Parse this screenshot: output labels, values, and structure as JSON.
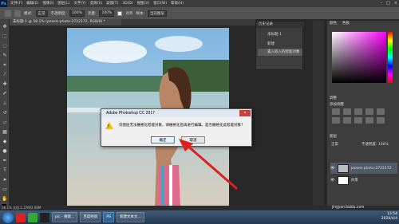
{
  "app": {
    "logo": "Ps"
  },
  "menubar": {
    "items": [
      "文件(F)",
      "编辑(E)",
      "图像(I)",
      "图层(L)",
      "文字(Y)",
      "选择(S)",
      "滤镜(T)",
      "3D(D)",
      "视图(V)",
      "窗口(W)",
      "帮助(H)"
    ],
    "controls": [
      "–",
      "□",
      "×"
    ]
  },
  "optionsbar": {
    "mode_label": "模式:",
    "mode_value": "正常",
    "opacity_label": "不透明度:",
    "opacity_value": "100%",
    "flow_label": "流量:",
    "flow_value": "100%",
    "align_label": "对齐",
    "sample_label": "样本:",
    "sample_value": "当前图层"
  },
  "document_tab": {
    "label": "未标题-1 @ 58.1% (pexels-photo-2722172, RGB/8) *"
  },
  "layer_popup": {
    "tab": "历史记录",
    "rows": [
      "未标题-1",
      "新建",
      "置入嵌入的智能对象"
    ]
  },
  "panels": {
    "color_tab": "颜色",
    "swatches_tab": "色板",
    "adjustments_tab": "调整",
    "adjustments_sub": "添加调整",
    "layers_tab": "图层",
    "blend_mode": "正常",
    "opacity_label": "不透明度: 100%",
    "layers": [
      {
        "name": "pexels-photo-2722172"
      },
      {
        "name": "背景"
      }
    ]
  },
  "dialog": {
    "title": "Adobe Photoshop CC 2017",
    "message": "仅图层无法栅格化智能对象，请栅格化后再进行编辑。是否栅格化此智能对象？",
    "ok_label": "确定",
    "cancel_label": "取消",
    "close_glyph": "×",
    "warn_glyph": "!"
  },
  "statusbar": {
    "text": "58.1%     文档:1.37M/2.66M"
  },
  "taskbar": {
    "items": [
      "pic - 搜索...",
      "百度经验",
      "PS",
      "新建文本文..."
    ],
    "time": "13:54",
    "date": "2020/4/4"
  },
  "watermark": "jingyan.baidu.com",
  "colors": {
    "dialog_bg": "#f0f0f0",
    "ps_dark": "#282828",
    "arrow": "#e02020"
  }
}
